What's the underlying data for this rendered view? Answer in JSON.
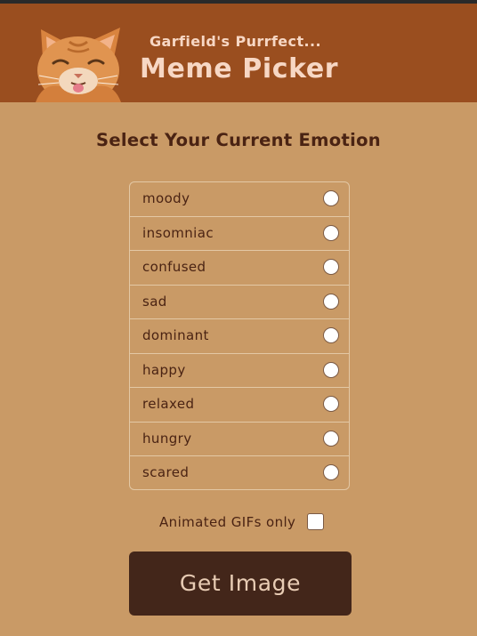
{
  "header": {
    "subtitle": "Garfield's Purrfect...",
    "title": "Meme Picker",
    "bg_color": "#9a4e1f",
    "text_color": "#f7d7c4"
  },
  "prompt": {
    "heading": "Select Your Current Emotion"
  },
  "emotions": [
    {
      "label": "moody",
      "selected": false
    },
    {
      "label": "insomniac",
      "selected": false
    },
    {
      "label": "confused",
      "selected": false
    },
    {
      "label": "sad",
      "selected": false
    },
    {
      "label": "dominant",
      "selected": false
    },
    {
      "label": "happy",
      "selected": false
    },
    {
      "label": "relaxed",
      "selected": false
    },
    {
      "label": "hungry",
      "selected": false
    },
    {
      "label": "scared",
      "selected": false
    }
  ],
  "gif_option": {
    "label": "Animated GIFs only",
    "checked": false
  },
  "action": {
    "button_label": "Get Image",
    "button_color": "#43261a"
  },
  "page_bg_color": "#c99a66"
}
